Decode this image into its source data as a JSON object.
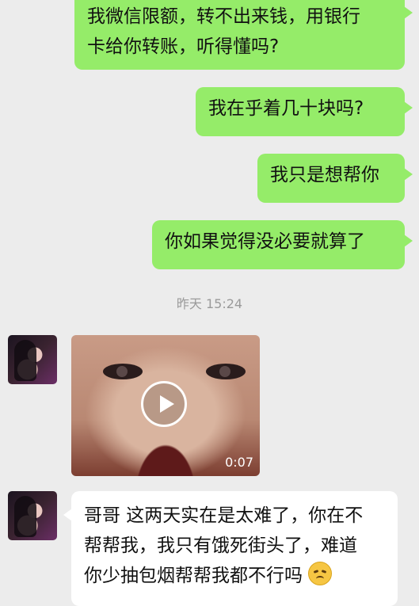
{
  "messages_out": [
    {
      "line1": "我微信限额，转不出来钱，用银行",
      "line2": "卡给你转账，听得懂吗?"
    },
    {
      "text": "我在乎着几十块吗?"
    },
    {
      "text": "我只是想帮你"
    },
    {
      "text": "你如果觉得没必要就算了"
    }
  ],
  "timestamp": "昨天 15:24",
  "video": {
    "duration": "0:07",
    "icon": "play-icon"
  },
  "message_in": {
    "line1": "哥哥 这两天实在是太难了，你在不",
    "line2": "帮帮我，我只有饿死街头了，难道",
    "line3": "你少抽包烟帮帮我都不行吗",
    "emoji": "sad-face-emoji"
  },
  "colors": {
    "outgoing_bubble": "#95ec69",
    "incoming_bubble": "#ffffff",
    "background": "#ececec"
  }
}
